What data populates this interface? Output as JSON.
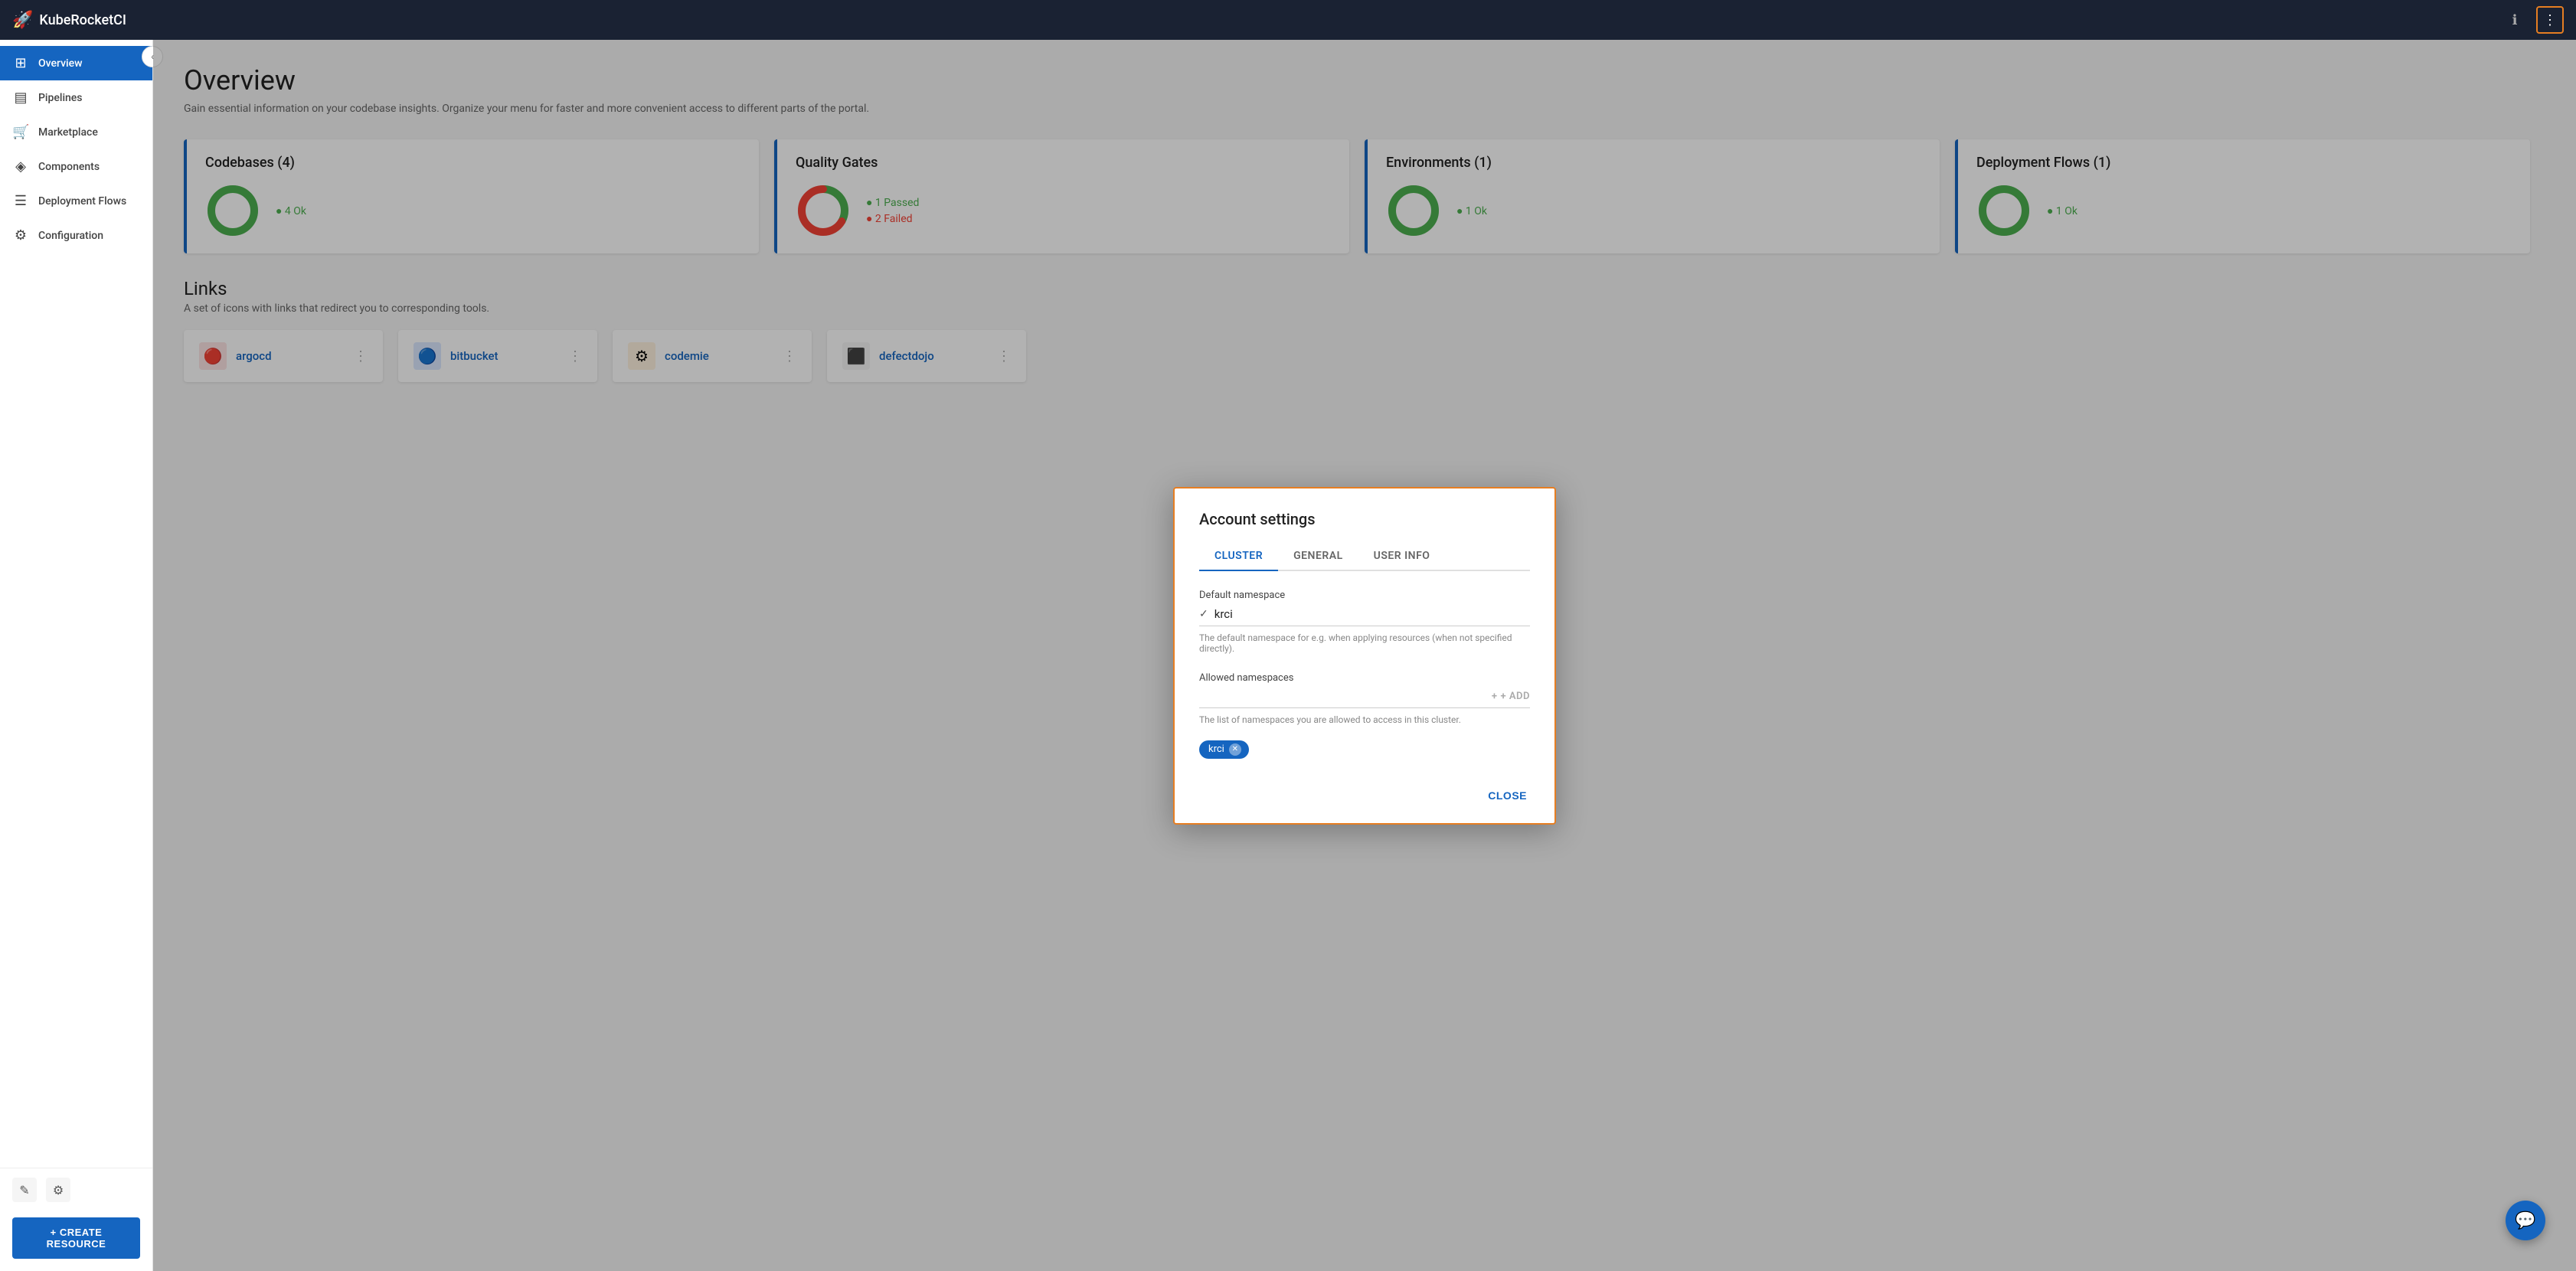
{
  "app": {
    "name": "KubeRocketCI",
    "logo_icon": "🚀"
  },
  "topnav": {
    "info_title": "Info",
    "menu_title": "Menu"
  },
  "sidebar": {
    "collapse_label": "Collapse",
    "items": [
      {
        "id": "overview",
        "label": "Overview",
        "icon": "⊞",
        "active": true
      },
      {
        "id": "pipelines",
        "label": "Pipelines",
        "icon": "▤"
      },
      {
        "id": "marketplace",
        "label": "Marketplace",
        "icon": "🛒"
      },
      {
        "id": "components",
        "label": "Components",
        "icon": "◈"
      },
      {
        "id": "deployment-flows",
        "label": "Deployment Flows",
        "icon": "☰"
      },
      {
        "id": "configuration",
        "label": "Configuration",
        "icon": "⚙"
      }
    ],
    "bottom_icons": [
      {
        "id": "edit",
        "icon": "✎"
      },
      {
        "id": "settings",
        "icon": "⚙"
      }
    ],
    "create_resource_label": "+ CREATE RESOURCE"
  },
  "main": {
    "title": "Overview",
    "subtitle": "Gain essential information on your codebase insights. Organize your menu for faster and more convenient access to different parts of the portal.",
    "cards": [
      {
        "id": "codebases",
        "title": "Codebases (4)",
        "stats": [
          {
            "label": "4 Ok",
            "type": "ok"
          }
        ],
        "donut": {
          "ok": 4,
          "total": 4,
          "color": "#4caf50"
        }
      },
      {
        "id": "quality-gates",
        "title": "Quality Gates",
        "stats": [
          {
            "label": "1 Passed",
            "type": "passed"
          },
          {
            "label": "2 Failed",
            "type": "failed"
          }
        ],
        "donut": {
          "passed": 1,
          "failed": 2,
          "total": 3,
          "color": "#4caf50",
          "fail_color": "#f44336"
        }
      },
      {
        "id": "environments",
        "title": "Environments (1)",
        "stats": [
          {
            "label": "1 Ok",
            "type": "ok"
          }
        ],
        "donut": {
          "ok": 1,
          "total": 1,
          "color": "#4caf50"
        }
      },
      {
        "id": "deployment-flows",
        "title": "Deployment Flows (1)",
        "stats": [
          {
            "label": "1 Ok",
            "type": "ok"
          }
        ],
        "donut": {
          "ok": 1,
          "total": 1,
          "color": "#4caf50"
        }
      }
    ],
    "links": {
      "title": "Links",
      "subtitle": "A set of icons with links that redirect you to corresponding tools.",
      "items": [
        {
          "id": "argocd",
          "label": "argocd",
          "icon": "🔴",
          "bg": "#e8f0fe"
        },
        {
          "id": "bitbucket",
          "label": "bitbucket",
          "icon": "🔵",
          "bg": "#dce8ff"
        },
        {
          "id": "codemie",
          "label": "codemie",
          "icon": "⚙",
          "bg": "#fff3e0"
        },
        {
          "id": "defectdojo",
          "label": "defectdojo",
          "icon": "⬛",
          "bg": "#f5f5f5"
        }
      ]
    }
  },
  "modal": {
    "title": "Account settings",
    "tabs": [
      {
        "id": "cluster",
        "label": "CLUSTER",
        "active": true
      },
      {
        "id": "general",
        "label": "GENERAL",
        "active": false
      },
      {
        "id": "user-info",
        "label": "USER INFO",
        "active": false
      }
    ],
    "cluster": {
      "default_namespace_label": "Default namespace",
      "default_namespace_value": "krci",
      "default_namespace_hint": "The default namespace for e.g. when applying resources (when not specified directly).",
      "allowed_namespaces_label": "Allowed namespaces",
      "allowed_namespaces_placeholder": "",
      "allowed_namespaces_hint": "The list of namespaces you are allowed to access in this cluster.",
      "add_label": "+ ADD",
      "chips": [
        {
          "id": "krci",
          "label": "krci"
        }
      ]
    },
    "close_label": "CLOSE"
  }
}
